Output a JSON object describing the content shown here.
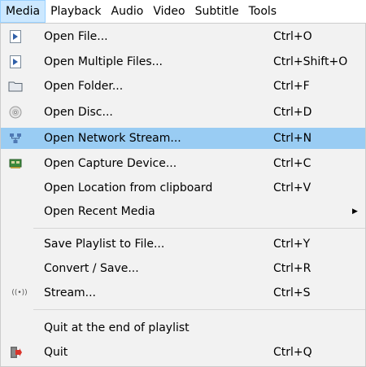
{
  "menubar": {
    "items": [
      "Media",
      "Playback",
      "Audio",
      "Video",
      "Subtitle",
      "Tools"
    ]
  },
  "menu": {
    "items": [
      {
        "label": "Open File...",
        "shortcut": "Ctrl+O",
        "icon": "play-file-icon"
      },
      {
        "label": "Open Multiple Files...",
        "shortcut": "Ctrl+Shift+O",
        "icon": "play-file-icon"
      },
      {
        "label": "Open Folder...",
        "shortcut": "Ctrl+F",
        "icon": "folder-icon"
      },
      {
        "label": "Open Disc...",
        "shortcut": "Ctrl+D",
        "icon": "disc-icon"
      },
      {
        "label": "Open Network Stream...",
        "shortcut": "Ctrl+N",
        "icon": "network-icon"
      },
      {
        "label": "Open Capture Device...",
        "shortcut": "Ctrl+C",
        "icon": "capture-card-icon"
      },
      {
        "label": "Open Location from clipboard",
        "shortcut": "Ctrl+V",
        "icon": ""
      },
      {
        "label": "Open Recent Media",
        "shortcut": "",
        "icon": ""
      },
      {
        "label": "Save Playlist to File...",
        "shortcut": "Ctrl+Y",
        "icon": ""
      },
      {
        "label": "Convert / Save...",
        "shortcut": "Ctrl+R",
        "icon": ""
      },
      {
        "label": "Stream...",
        "shortcut": "Ctrl+S",
        "icon": "stream-icon"
      },
      {
        "label": "Quit at the end of playlist",
        "shortcut": "",
        "icon": ""
      },
      {
        "label": "Quit",
        "shortcut": "Ctrl+Q",
        "icon": "quit-icon"
      }
    ],
    "highlighted_item": "Open Network Stream...",
    "stream_glyph": "((•))"
  },
  "colors": {
    "highlight": "#99ccf3",
    "menu_background": "#f2f2f2",
    "active_menubar": "#cce8ff"
  }
}
